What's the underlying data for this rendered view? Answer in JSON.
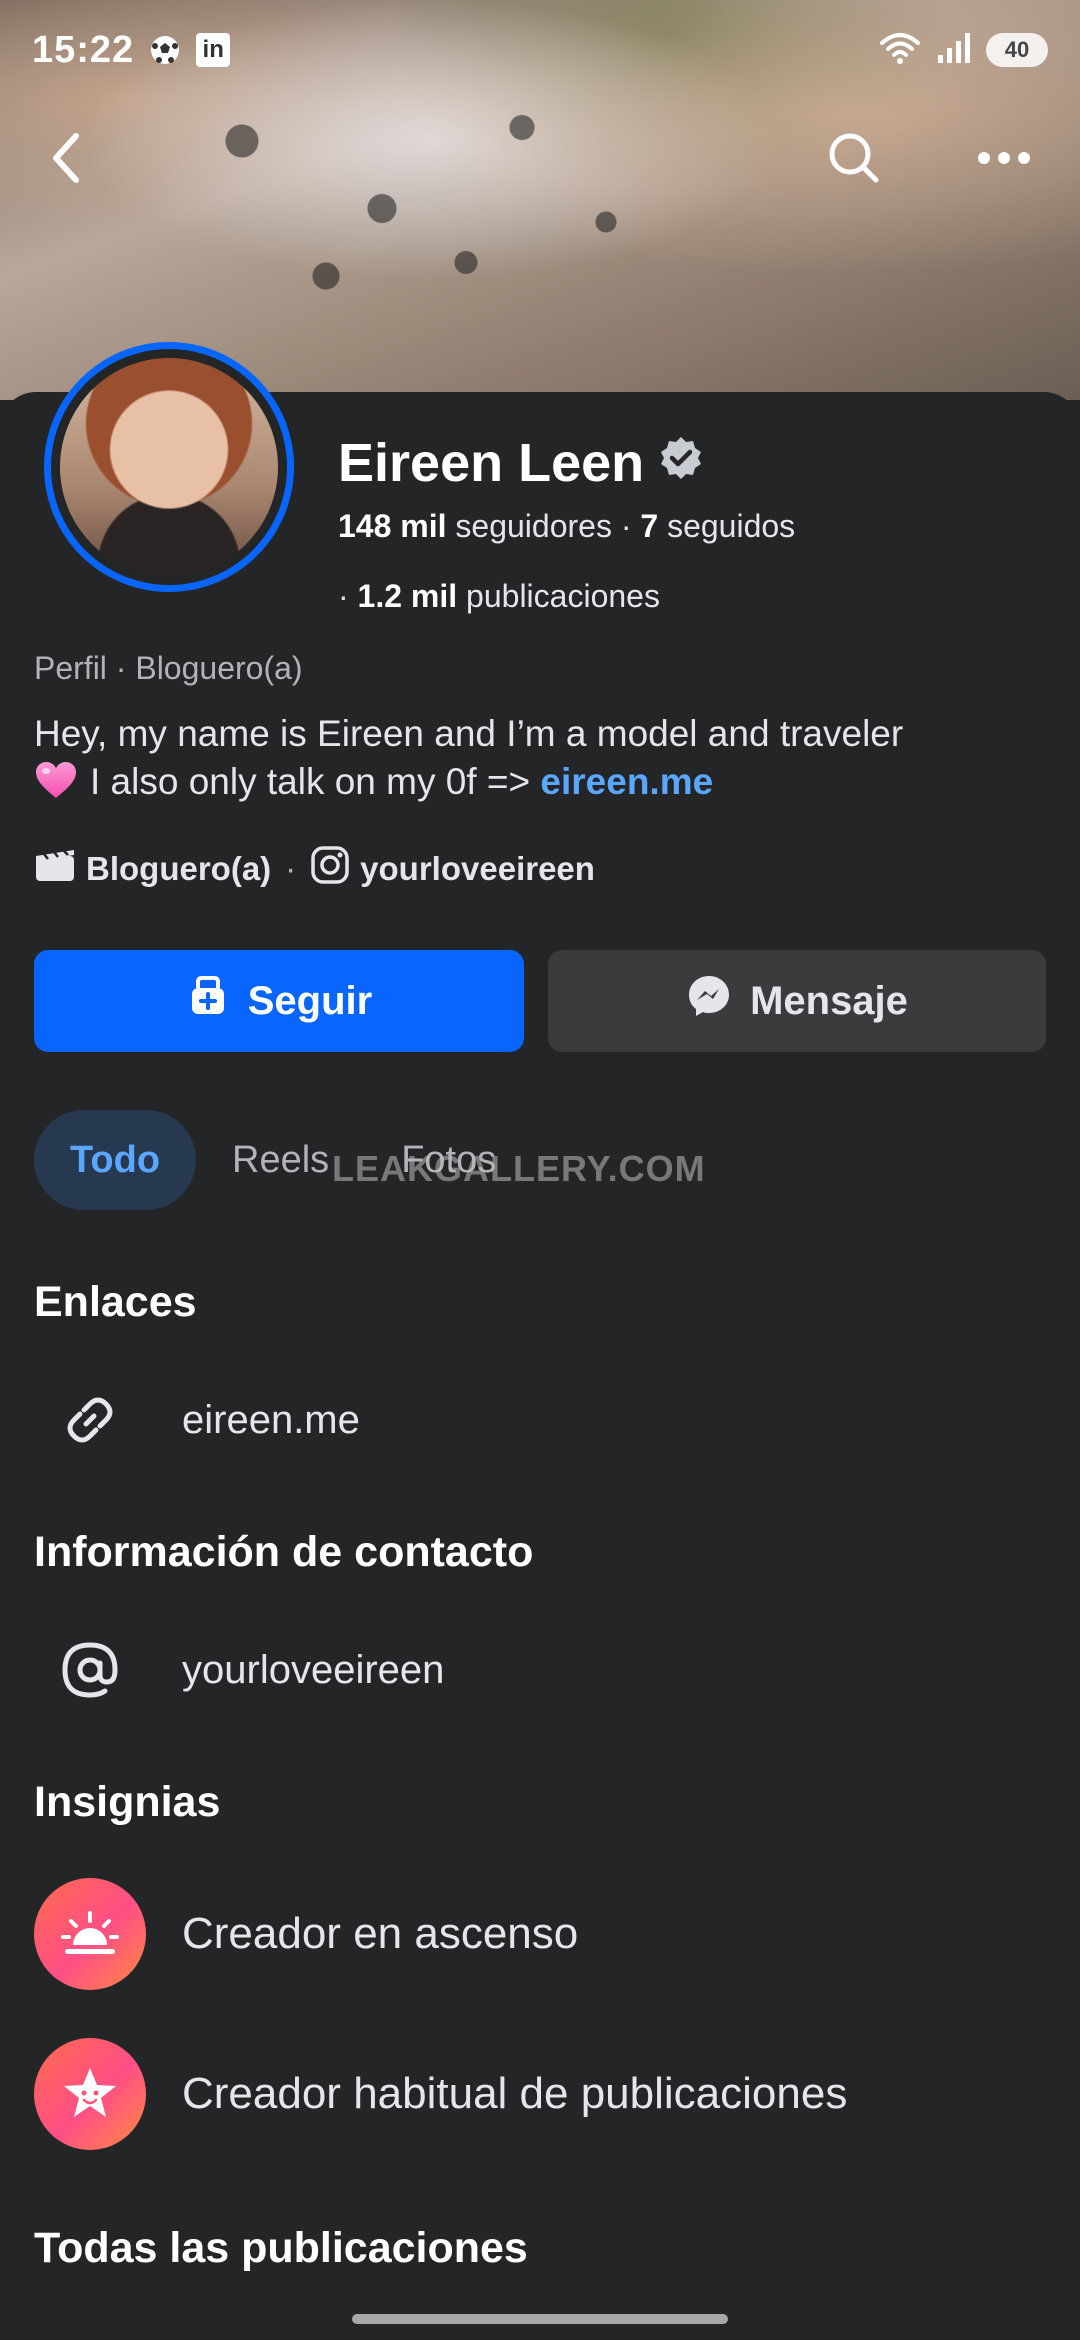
{
  "status_bar": {
    "time": "15:22",
    "linkedin_label": "in",
    "battery": "40",
    "icons": [
      "soccer-ball-icon",
      "linkedin-icon",
      "wifi-icon",
      "signal-icon",
      "battery-icon"
    ]
  },
  "cover_nav": {
    "icons": [
      "back-arrow-icon",
      "search-icon",
      "more-options-icon"
    ]
  },
  "profile": {
    "name": "Eireen Leen",
    "followers_count": "148 mil",
    "followers_label": "seguidores",
    "following_count": "7",
    "following_label": "seguidos",
    "posts_count": "1.2 mil",
    "posts_label": "publicaciones",
    "category": "Perfil · Bloguero(a)",
    "bio_line1": "Hey, my name is Eireen and I’m a model and traveler",
    "bio_line2": "I also only talk on my 0f => ",
    "bio_link": "eireen.me",
    "meta_category": "Bloguero(a)",
    "meta_instagram": "yourloveeireen"
  },
  "actions": {
    "follow_label": "Seguir",
    "message_label": "Mensaje"
  },
  "tabs": [
    {
      "label": "Todo",
      "active": true
    },
    {
      "label": "Reels",
      "active": false
    },
    {
      "label": "Fotos",
      "active": false
    }
  ],
  "watermark": "LEAKGALLERY.COM",
  "sections": {
    "links_title": "Enlaces",
    "link_value": "eireen.me",
    "contact_title": "Información de contacto",
    "contact_value": "yourloveeireen",
    "badges_title": "Insignias",
    "badges": [
      "Creador en ascenso",
      "Creador habitual de publicaciones"
    ],
    "all_posts_title": "Todas las publicaciones"
  },
  "colors": {
    "accent": "#0866ff",
    "link": "#5aa7ff",
    "background": "#242527",
    "secondary_button": "#3a3b3c"
  }
}
